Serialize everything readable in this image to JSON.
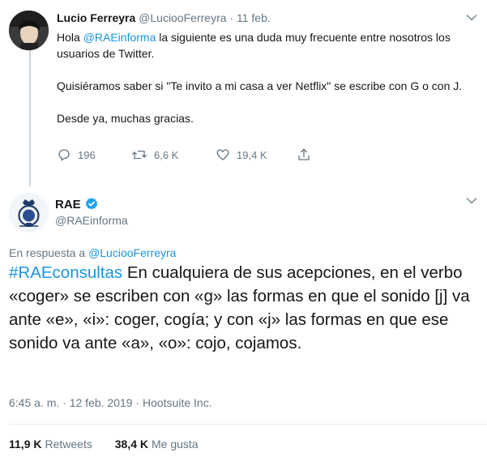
{
  "tweet1": {
    "author_name": "Lucio Ferreyra",
    "author_handle": "@LucioоFerreyra",
    "separator": "·",
    "date": "11 feb.",
    "line1_prefix": "Hola ",
    "line1_mention": "@RAEinforma",
    "line1_rest": " la siguiente es una duda muy frecuente entre nosotros los usuarios de Twitter.",
    "line2": "Quisiéramos saber si \"Te invito a mi casa a ver Netflix\" se escribe con G o con J.",
    "line3": "Desde ya, muchas gracias.",
    "actions": {
      "reply_count": "196",
      "retweet_count": "6,6 K",
      "like_count": "19,4 K"
    },
    "icons": [
      "reply-icon",
      "retweet-icon",
      "like-icon",
      "share-icon",
      "chevron-down-icon"
    ]
  },
  "tweet2": {
    "author_name": "RAE",
    "author_handle": "@RAEinforma",
    "reply_prefix": "En respuesta a ",
    "reply_to": "@LucioоFerreyra",
    "hashtag": "#RAEconsultas",
    "text": " En cualquiera de sus acepciones, en el verbo «coger» se escriben con «g» las formas en que el sonido [j] va ante «e», «i»: coger, cogía; y con «j» las formas en que ese sonido va ante «a», «o»: cojo, cojamos.",
    "meta": "6:45 a. m. · 12 feb. 2019 · Hootsuite Inc.",
    "retweets_count": "11,9 K",
    "retweets_label": "Retweets",
    "likes_count": "38,4 K",
    "likes_label": "Me gusta",
    "icons": [
      "verified-icon",
      "rae-logo-icon",
      "chevron-down-icon"
    ]
  },
  "colors": {
    "link": "#1b95e0",
    "secondary": "#657786",
    "text": "#14171a",
    "thread_line": "#cbd5dc",
    "verified": "#1da1f2"
  }
}
